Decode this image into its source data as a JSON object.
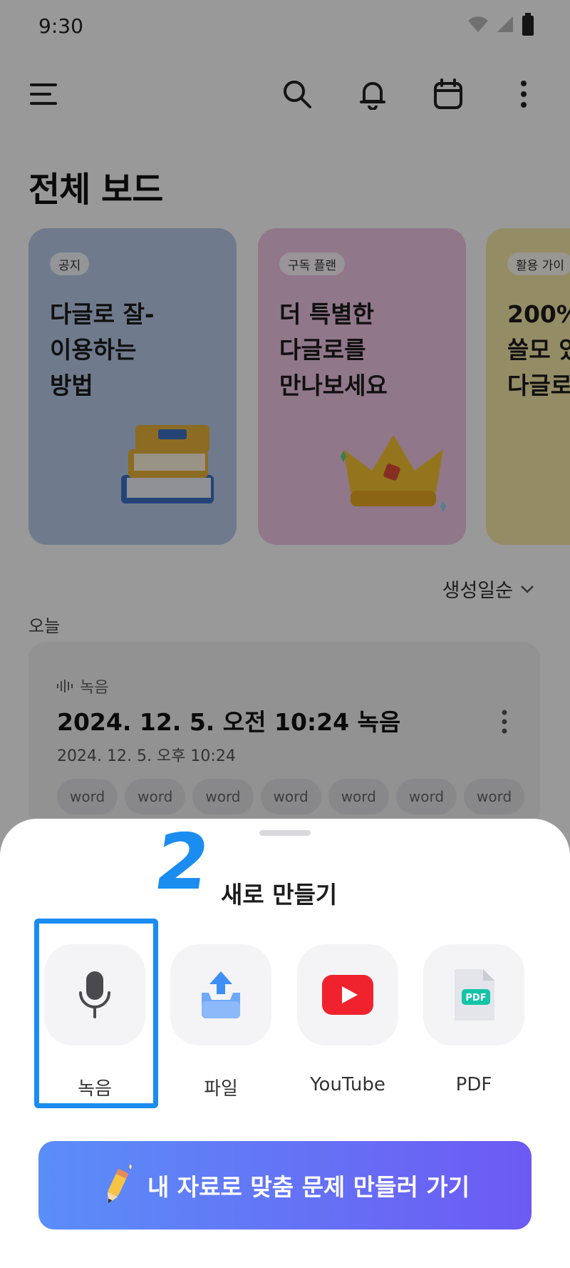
{
  "status_bar": {
    "time": "9:30"
  },
  "header": {
    "title": "전체 보드"
  },
  "cards": [
    {
      "badge": "공지",
      "text": "다글로 잘-\n이용하는\n방법"
    },
    {
      "badge": "구독 플랜",
      "text": "더 특별한\n다글로를\n만나보세요"
    },
    {
      "badge": "활용 가이",
      "text": "200%\n쓸모 있\n다글로"
    }
  ],
  "sort": {
    "label": "생성일순"
  },
  "section": {
    "today": "오늘"
  },
  "record": {
    "kind": "녹음",
    "title": "2024. 12. 5. 오전 10:24 녹음",
    "date": "2024. 12. 5. 오후 10:24",
    "tags": [
      "word",
      "word",
      "word",
      "word",
      "word",
      "word",
      "word"
    ]
  },
  "sheet": {
    "annotation": "2",
    "title": "새로 만들기",
    "options": [
      {
        "label": "녹음",
        "icon": "microphone-icon"
      },
      {
        "label": "파일",
        "icon": "upload-tray-icon"
      },
      {
        "label": "YouTube",
        "icon": "youtube-play-icon"
      },
      {
        "label": "PDF",
        "icon": "pdf-file-icon",
        "badge": "PDF"
      }
    ],
    "cta": "내 자료로 맞춤 문제 만들러 가기"
  },
  "colors": {
    "accent": "#1b8cf0",
    "youtube": "#f0222e",
    "pdf_badge": "#14c4a8",
    "upload": "#3e8ef5",
    "cta_start": "#5a8ef8",
    "cta_end": "#6d5af3"
  }
}
